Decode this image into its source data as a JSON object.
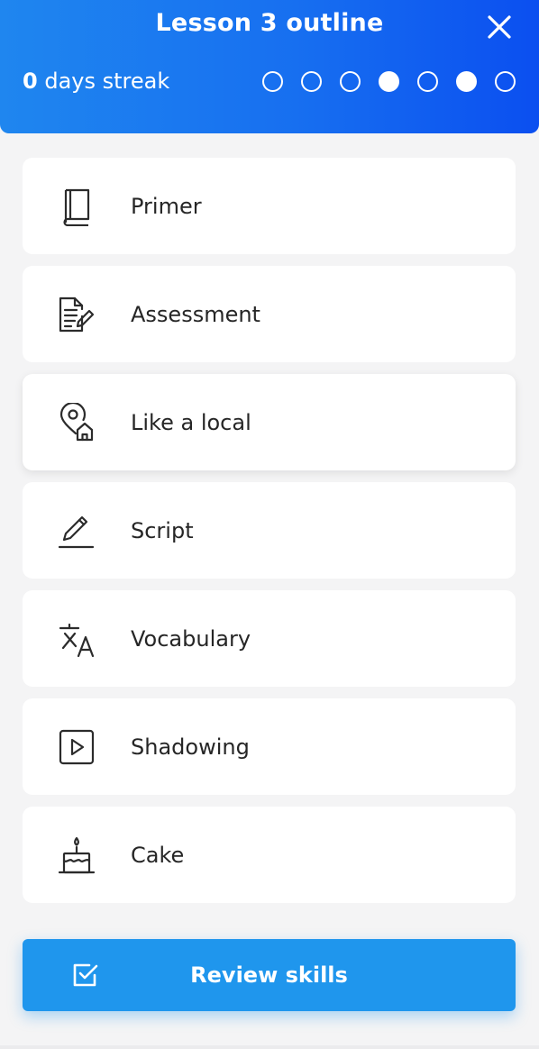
{
  "header": {
    "title": "Lesson 3 outline",
    "close_icon": "close-icon",
    "streak_count": "0",
    "streak_text": " days streak",
    "progress_dots": [
      false,
      false,
      false,
      true,
      false,
      true,
      false
    ]
  },
  "items": [
    {
      "label": "Primer",
      "icon": "book-icon"
    },
    {
      "label": "Assessment",
      "icon": "document-edit-icon"
    },
    {
      "label": "Like a local",
      "icon": "location-home-icon"
    },
    {
      "label": "Script",
      "icon": "pencil-icon"
    },
    {
      "label": "Vocabulary",
      "icon": "translate-icon"
    },
    {
      "label": "Shadowing",
      "icon": "play-icon"
    },
    {
      "label": "Cake",
      "icon": "cake-icon"
    }
  ],
  "review_button": {
    "label": "Review skills",
    "icon": "checkbox-icon"
  },
  "colors": {
    "header_start": "#1f86ef",
    "header_end": "#0b4ff0",
    "button": "#1f96ed",
    "background": "#f4f4f5"
  }
}
